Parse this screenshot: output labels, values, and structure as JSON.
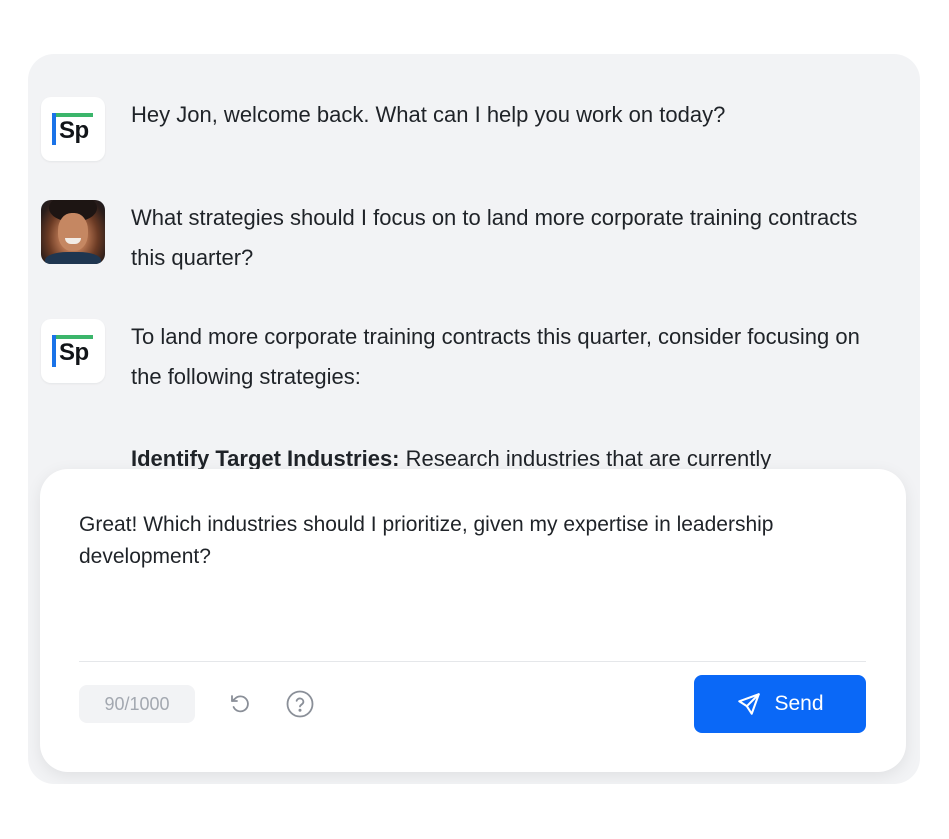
{
  "conversation": {
    "messages": [
      {
        "role": "assistant",
        "avatar_text": "Sp",
        "text": "Hey Jon, welcome back. What can I help you work on today?"
      },
      {
        "role": "user",
        "text": "What strategies should I focus on to land more corporate training contracts this quarter?"
      },
      {
        "role": "assistant",
        "avatar_text": "Sp",
        "text": "To land more corporate training contracts this quarter, consider focusing on the following strategies:",
        "list_item_heading": "Identify Target Industries:",
        "list_item_text": "Research industries that are currently"
      }
    ]
  },
  "composer": {
    "input_value": "Great! Which industries should I prioritize, given my expertise in leadership development?",
    "char_count": "90/1000",
    "send_label": "Send"
  },
  "icons": {
    "reset": "rotate-ccw-icon",
    "help": "help-circle-icon",
    "send": "send-icon"
  },
  "colors": {
    "panel_bg": "#f2f3f5",
    "accent": "#0a68f7",
    "logo_green": "#3bb56b",
    "logo_blue": "#1a73e8"
  }
}
